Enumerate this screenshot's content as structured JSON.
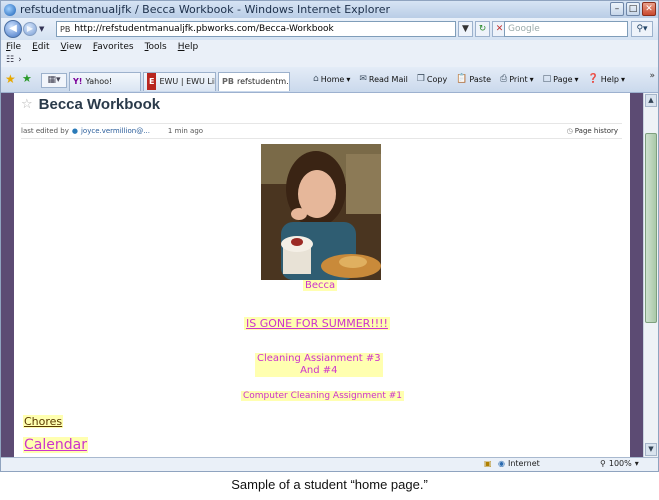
{
  "window": {
    "title": "refstudentmanualjfk / Becca Workbook - Windows Internet Explorer"
  },
  "address": {
    "prefix": "PB",
    "url": "http://refstudentmanualjfk.pbworks.com/Becca-Workbook",
    "search_placeholder": "Google"
  },
  "menu": [
    "File",
    "Edit",
    "View",
    "Favorites",
    "Tools",
    "Help"
  ],
  "tabs": [
    {
      "icon": "Y!",
      "label": "Yahoo!"
    },
    {
      "icon": "E",
      "label": "EWU | EWU Libr..."
    },
    {
      "icon": "PB",
      "label": "refstudentm..."
    }
  ],
  "commands": {
    "home": "Home",
    "read_mail": "Read Mail",
    "copy": "Copy",
    "paste": "Paste",
    "print": "Print",
    "page": "Page",
    "help": "Help"
  },
  "page": {
    "title": "Becca Workbook",
    "edited_prefix": "last edited by",
    "edited_user": "joyce.vermillion@...",
    "edited_time": "1 min ago",
    "history_label": "Page history"
  },
  "content": {
    "photo_caption": "Becca",
    "gone": "IS GONE FOR SUMMER!!!!",
    "cleaning_line1": "Cleaning Assianment #3",
    "cleaning_line2": "And #4",
    "computer_cleaning": "Computer Cleaning Assignment #1",
    "chores": "Chores",
    "calendar": "Calendar"
  },
  "status": {
    "zone": "Internet",
    "zoom": "100%"
  },
  "caption": "Sample of a student “home page.”",
  "colors": {
    "highlight": "#ffffb0",
    "pink_text": "#cc33cc",
    "side_strip": "#5c4b73"
  }
}
